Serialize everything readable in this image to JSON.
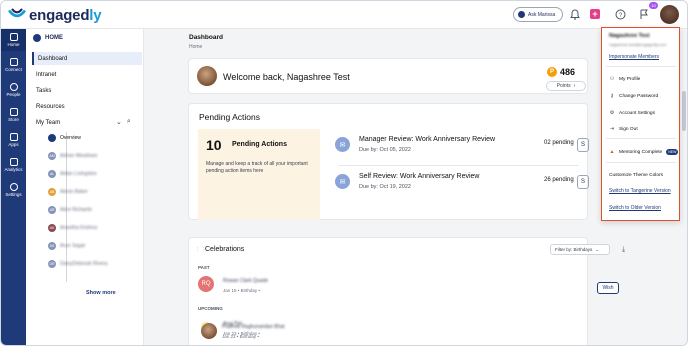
{
  "app": {
    "brand_prefix": "engaged",
    "brand_suffix": "ly"
  },
  "topbar": {
    "ask_label": "Ask Marissa",
    "notification_badge": "10"
  },
  "rail": {
    "items": [
      {
        "label": "Home",
        "icon": "home-icon"
      },
      {
        "label": "Connect",
        "icon": "connect-icon"
      },
      {
        "label": "People",
        "icon": "people-icon"
      },
      {
        "label": "Store",
        "icon": "store-icon"
      },
      {
        "label": "Apps",
        "icon": "apps-icon"
      },
      {
        "label": "Analytics",
        "icon": "analytics-icon"
      },
      {
        "label": "Settings",
        "icon": "settings-icon"
      }
    ]
  },
  "sidebar": {
    "header": "HOME",
    "items": [
      "Dashboard",
      "Intranet",
      "Tasks",
      "Resources",
      "My Team"
    ],
    "team": [
      {
        "label": "Overview",
        "initials": ""
      },
      {
        "label": "Adrian Meadows",
        "initials": "AM"
      },
      {
        "label": "Aidan Livingston",
        "initials": "AL"
      },
      {
        "label": "Alexis Baker",
        "initials": "AB"
      },
      {
        "label": "Alice Richards",
        "initials": "AR"
      },
      {
        "label": "Anantha Krishna",
        "initials": "AK"
      },
      {
        "label": "Arun Sagar",
        "initials": "AS"
      },
      {
        "label": "DaisyDeborah Rivera",
        "initials": "DR"
      }
    ],
    "show_more": "Show more"
  },
  "main": {
    "title": "Dashboard",
    "breadcrumb": "Home",
    "welcome": "Welcome back, Nagashree Test",
    "points_value": "486",
    "points_label": "Points",
    "pending": {
      "title": "Pending Actions",
      "count": "10",
      "box_label": "Pending Actions",
      "desc": "Manage and keep a track of all your important pending action items here",
      "reviews": [
        {
          "title": "Manager Review: Work Anniversary Review",
          "due": "Due by: Oct 05, 2022",
          "pending": "02 pending",
          "btn": "S"
        },
        {
          "title": "Self Review: Work Anniversary Review",
          "due": "Due by: Oct 19, 2022",
          "pending": "26 pending",
          "btn": "S"
        }
      ]
    },
    "celebrations": {
      "title": "Celebrations",
      "filter": "Filter by: Birthdays",
      "past_label": "PAST",
      "upcoming_label": "UPCOMING",
      "wish_label": "Wish",
      "people": [
        {
          "name": "Rowan Clark Quade",
          "initials": "RQ",
          "meta": "Jan 15 • Birthday •"
        },
        {
          "name": "Anuj Pal",
          "initials": "",
          "meta": "Jan 23 • Birthday •"
        },
        {
          "name": "Prathvik Raghunandan Bhat",
          "initials": "",
          "meta": "Jan 23 • Birthday •"
        }
      ]
    }
  },
  "dropdown": {
    "name": "Nagashree Test",
    "email": "nagashree.test@engagedly.com",
    "impersonate": "Impersonate Members",
    "items": [
      "My Profile",
      "Change Password",
      "Account Settings",
      "Sign Out"
    ],
    "mentoring": "Mentoring Complete",
    "new_label": "NEW",
    "theme_label": "Customize Theme Colors",
    "tangerine": "Switch to Tangerine Version",
    "older": "Switch to Older Version"
  },
  "colors": {
    "primary": "#1e3a78",
    "accent": "#1a9bd7",
    "highlight_border": "#e04e2b"
  }
}
